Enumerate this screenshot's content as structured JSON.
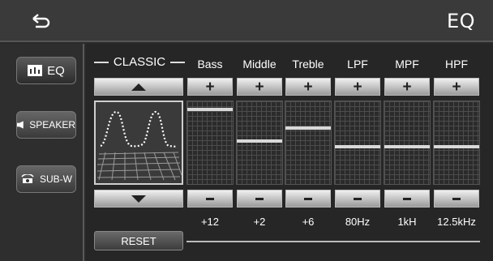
{
  "header": {
    "title": "EQ"
  },
  "sidebar": {
    "items": [
      {
        "label": "EQ",
        "icon": "equalizer-icon",
        "active": true
      },
      {
        "label": "SPEAKER",
        "icon": "speaker-icon",
        "active": false
      },
      {
        "label": "SUB-W",
        "icon": "subwoofer-icon",
        "active": false
      }
    ]
  },
  "preset": {
    "name": "CLASSIC"
  },
  "bands": [
    {
      "label": "Bass",
      "value": "+12",
      "level": 0.92
    },
    {
      "label": "Middle",
      "value": "+2",
      "level": 0.52
    },
    {
      "label": "Treble",
      "value": "+6",
      "level": 0.68
    },
    {
      "label": "LPF",
      "value": "80Hz",
      "level": 0.45
    },
    {
      "label": "MPF",
      "value": "1kH",
      "level": 0.45
    },
    {
      "label": "HPF",
      "value": "12.5kHz",
      "level": 0.45
    }
  ],
  "reset_label": "RESET",
  "colors": {
    "background": "#262626",
    "button_light": "#f0f0f0",
    "level_line": "#d9d9d9"
  }
}
